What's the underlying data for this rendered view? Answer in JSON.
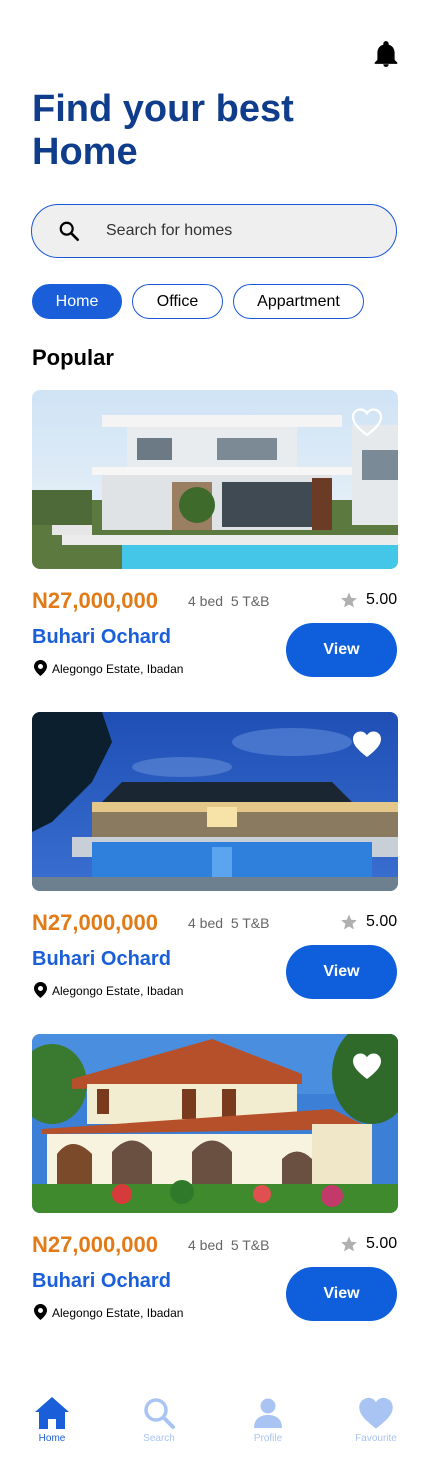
{
  "header": {
    "title": "Find your best Home"
  },
  "search": {
    "placeholder": "Search for homes"
  },
  "categories": [
    {
      "label": "Home",
      "active": true
    },
    {
      "label": "Office",
      "active": false
    },
    {
      "label": "Appartment",
      "active": false
    }
  ],
  "section": {
    "title": "Popular"
  },
  "listings": [
    {
      "price": "N27,000,000",
      "meta": "4 bed  5 T&B",
      "rating": "5.00",
      "name": "Buhari Ochard",
      "location": "Alegongo Estate, Ibadan",
      "cta": "View",
      "favourite": false
    },
    {
      "price": "N27,000,000",
      "meta": "4 bed  5 T&B",
      "rating": "5.00",
      "name": "Buhari Ochard",
      "location": "Alegongo Estate, Ibadan",
      "cta": "View",
      "favourite": true
    },
    {
      "price": "N27,000,000",
      "meta": "4 bed  5 T&B",
      "rating": "5.00",
      "name": "Buhari Ochard",
      "location": "Alegongo Estate, Ibadan",
      "cta": "View",
      "favourite": true
    }
  ],
  "nav": [
    {
      "label": "Home",
      "icon": "home-icon",
      "active": true
    },
    {
      "label": "Search",
      "icon": "search-icon",
      "active": false
    },
    {
      "label": "Profile",
      "icon": "profile-icon",
      "active": false
    },
    {
      "label": "Favourite",
      "icon": "heart-icon",
      "active": false
    }
  ],
  "colors": {
    "primary": "#1a5fd9",
    "title": "#0f3d8c",
    "price": "#e17b18",
    "nav_inactive": "#a9c4f3"
  }
}
